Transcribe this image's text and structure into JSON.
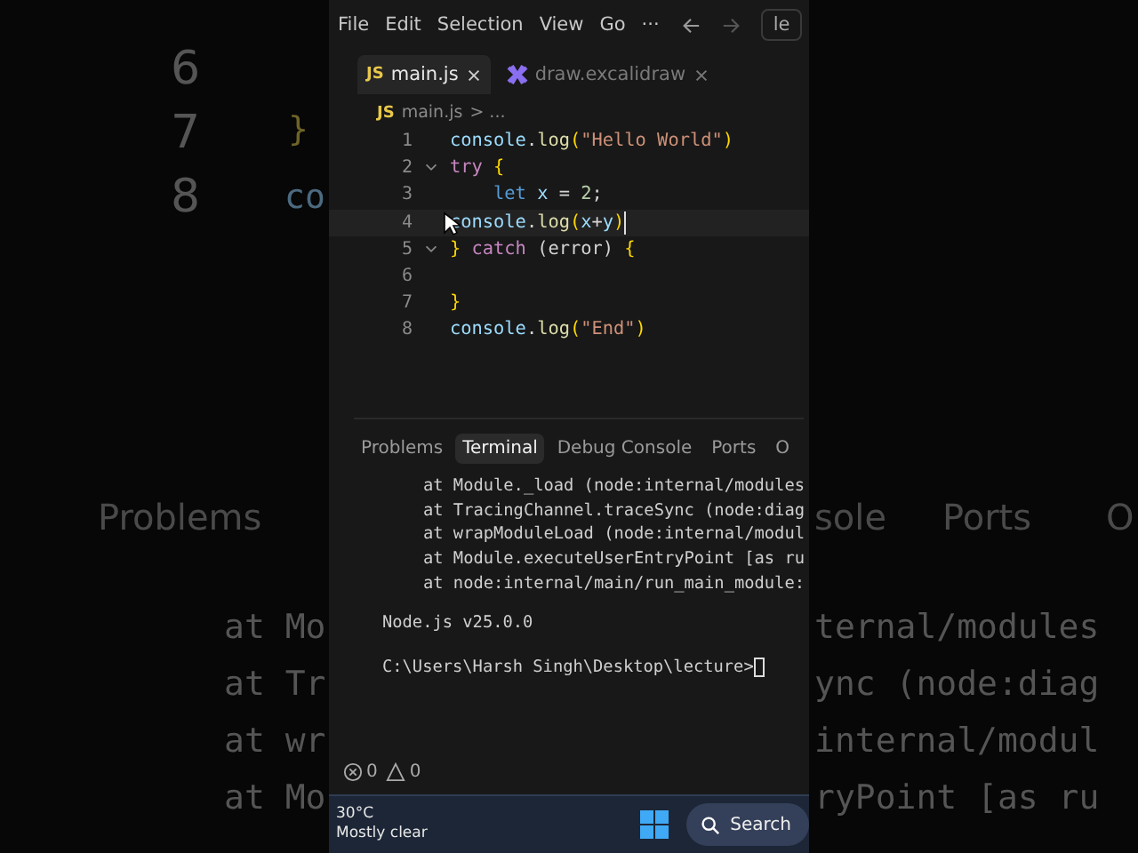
{
  "backdrop_fragments": [
    {
      "text": "6",
      "kind": "number"
    },
    {
      "text": "7",
      "kind": "number"
    },
    {
      "text": "}",
      "kind": "brace"
    },
    {
      "text": "8",
      "kind": "number"
    },
    {
      "text": "co",
      "kind": "code"
    },
    {
      "text": "Problems",
      "kind": "ui"
    },
    {
      "text": "sole",
      "kind": "ui"
    },
    {
      "text": "Ports",
      "kind": "ui"
    },
    {
      "text": "O",
      "kind": "ui"
    },
    {
      "text": "at Mo",
      "kind": "terminal"
    },
    {
      "text": "at Tr",
      "kind": "terminal"
    },
    {
      "text": "at wr",
      "kind": "terminal"
    },
    {
      "text": "at Mo",
      "kind": "terminal"
    },
    {
      "text": "ternal/modules",
      "kind": "terminal"
    },
    {
      "text": "ync (node:diag",
      "kind": "terminal"
    },
    {
      "text": "internal/modul",
      "kind": "terminal"
    },
    {
      "text": "ryPoint [as ru",
      "kind": "terminal"
    }
  ],
  "menu": [
    "File",
    "Edit",
    "Selection",
    "View",
    "Go",
    "···"
  ],
  "command_center": {
    "value": "le"
  },
  "tabs": [
    {
      "badge": "JS",
      "label": "main.js",
      "selected": true
    },
    {
      "label": "draw.excalidraw",
      "selected": false
    }
  ],
  "breadcrumb": {
    "icon": "JS",
    "file": "main.js",
    "rest": "> ..."
  },
  "code_lines": [
    {
      "number": "1",
      "tokens": [
        {
          "text": "console",
          "kind": "var"
        },
        {
          "text": ".",
          "kind": "plain"
        },
        {
          "text": "log",
          "kind": "fn"
        },
        {
          "text": "(",
          "kind": "paren"
        },
        {
          "text": "\"Hello World\"",
          "kind": "string"
        },
        {
          "text": ")",
          "kind": "paren"
        }
      ]
    },
    {
      "number": "2",
      "expanded": true,
      "tokens": [
        {
          "text": "try",
          "kind": "keyword"
        },
        {
          "text": " {",
          "kind": "paren"
        }
      ]
    },
    {
      "number": "3",
      "tokens": [
        {
          "text": "    let",
          "kind": "decl"
        },
        {
          "text": " x",
          "kind": "var"
        },
        {
          "text": " = ",
          "kind": "plain"
        },
        {
          "text": "2",
          "kind": "number"
        },
        {
          "text": ";",
          "kind": "plain"
        }
      ]
    },
    {
      "number": "4",
      "current": true,
      "tokens": [
        {
          "text": "console",
          "kind": "var"
        },
        {
          "text": ".",
          "kind": "plain"
        },
        {
          "text": "log",
          "kind": "fn"
        },
        {
          "text": "(",
          "kind": "paren"
        },
        {
          "text": "x",
          "kind": "var"
        },
        {
          "text": "+",
          "kind": "plain"
        },
        {
          "text": "y",
          "kind": "var"
        },
        {
          "text": ")",
          "kind": "paren"
        }
      ]
    },
    {
      "number": "5",
      "expanded": true,
      "tokens": [
        {
          "text": "}",
          "kind": "paren"
        },
        {
          "text": " catch",
          "kind": "keyword"
        },
        {
          "text": " (error) ",
          "kind": "plain"
        },
        {
          "text": "{",
          "kind": "paren"
        }
      ]
    },
    {
      "number": "6"
    },
    {
      "number": "7",
      "tokens": [
        {
          "text": "}",
          "kind": "paren"
        }
      ]
    },
    {
      "number": "8",
      "tokens": [
        {
          "text": "console",
          "kind": "var"
        },
        {
          "text": ".",
          "kind": "plain"
        },
        {
          "text": "log",
          "kind": "fn"
        },
        {
          "text": "(",
          "kind": "paren"
        },
        {
          "text": "\"End\"",
          "kind": "string"
        },
        {
          "text": ")",
          "kind": "paren"
        }
      ]
    }
  ],
  "panel_tabs": [
    {
      "label": "Problems",
      "selected": false
    },
    {
      "label": "Terminal",
      "selected": true
    },
    {
      "label": "Debug Console",
      "selected": false
    },
    {
      "label": "Ports",
      "selected": false
    },
    {
      "label": "O",
      "selected": false
    }
  ],
  "terminal": {
    "stack": [
      "at Module._load (node:internal/modules",
      "at TracingChannel.traceSync (node:diag",
      "at wrapModuleLoad (node:internal/modul",
      "at Module.executeUserEntryPoint [as ru",
      "at node:internal/main/run_main_module:"
    ],
    "version": "Node.js v25.0.0",
    "prompt": "C:\\Users\\Harsh Singh\\Desktop\\lecture>"
  },
  "status_bar": {
    "errors": "0",
    "warnings": "0"
  },
  "taskbar": {
    "temperature": "30°C",
    "weather": "Mostly clear",
    "search": "Search"
  }
}
